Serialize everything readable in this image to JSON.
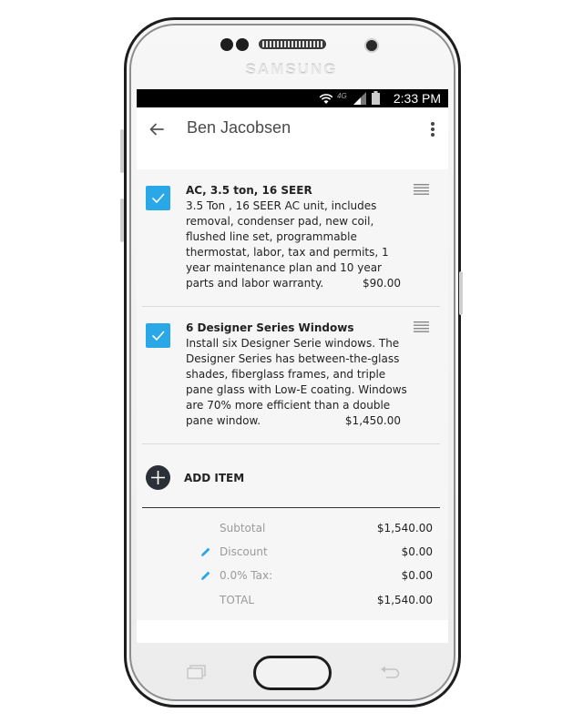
{
  "device": {
    "brand": "SAMSUNG"
  },
  "status_bar": {
    "time": "2:33 PM",
    "network": "4G",
    "icons": [
      "wifi-icon",
      "signal-icon",
      "battery-icon"
    ]
  },
  "app_bar": {
    "title": "Ben Jacobsen",
    "back_icon": "arrow-back-icon",
    "menu_icon": "more-vert-icon"
  },
  "items": [
    {
      "checked": true,
      "title": "AC, 3.5 ton, 16 SEER",
      "description": "3.5 Ton , 16 SEER AC unit, includes removal, condenser pad, new coil, flushed line set, programmable thermostat, labor, tax and permits, 1 year maintenance plan and 10 year parts and labor warranty.",
      "price": "$90.00"
    },
    {
      "checked": true,
      "title": "6 Designer Series Windows",
      "description": "Install six Designer Serie windows. The Designer Series has between-the-glass shades, fiberglass frames, and triple pane glass with Low-E coating. Windows are 70% more efficient than a double pane window.",
      "price": "$1,450.00"
    }
  ],
  "add_item": {
    "label": "ADD ITEM"
  },
  "totals": {
    "subtotal_label": "Subtotal",
    "subtotal_value": "$1,540.00",
    "discount_label": "Discount",
    "discount_value": "$0.00",
    "tax_label": "0.0% Tax:",
    "tax_value": "$0.00",
    "total_label": "TOTAL",
    "total_value": "$1,540.00"
  },
  "colors": {
    "accent": "#2aa7e6",
    "add_button": "#2b2f36",
    "text": "#222222",
    "muted": "#9a9a9a"
  }
}
